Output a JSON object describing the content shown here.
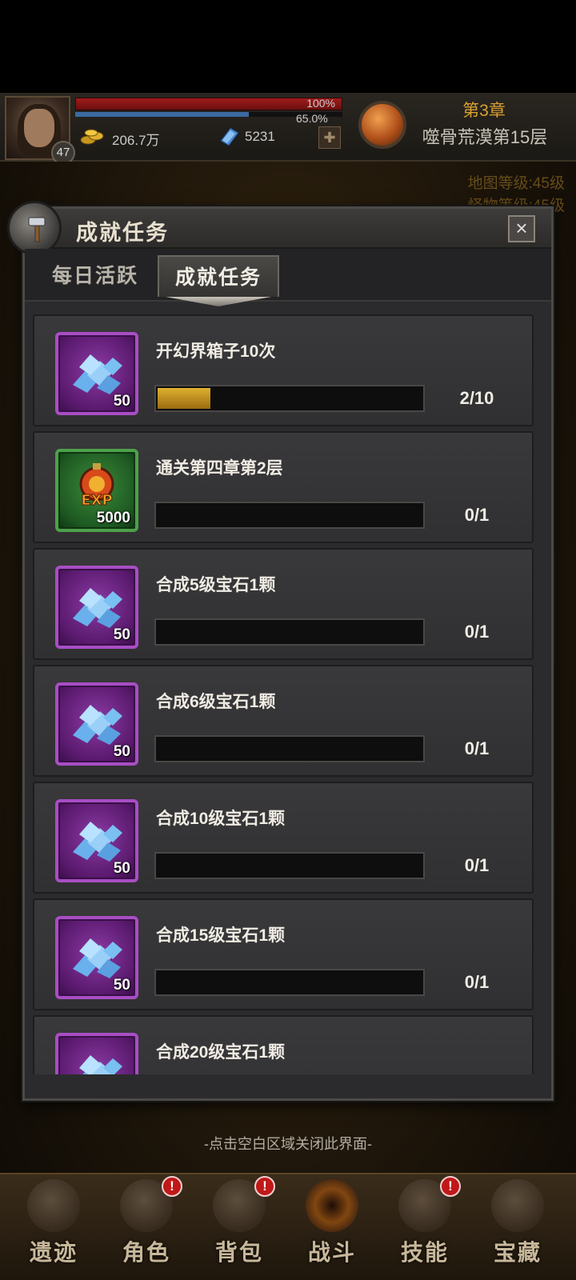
{
  "hud": {
    "level": "47",
    "hp_percent": "100%",
    "exp_percent": "65.0%",
    "gold": "206.7万",
    "gems": "5231",
    "chapter": "第3章",
    "stage": "噬骨荒漠第15层"
  },
  "map_info": [
    "地图等级:45级",
    "怪物等级:45级"
  ],
  "panel": {
    "title": "成就任务",
    "close_symbol": "×",
    "tabs": [
      {
        "label": "每日活跃",
        "active": false
      },
      {
        "label": "成就任务",
        "active": true
      }
    ]
  },
  "tasks": [
    {
      "title": "开幻界箱子10次",
      "reward_type": "gem",
      "reward_count": "50",
      "progress_text": "2/10",
      "progress": 0.2
    },
    {
      "title": "通关第四章第2层",
      "reward_type": "exp",
      "reward_count": "5000",
      "progress_text": "0/1",
      "progress": 0
    },
    {
      "title": "合成5级宝石1颗",
      "reward_type": "gem",
      "reward_count": "50",
      "progress_text": "0/1",
      "progress": 0
    },
    {
      "title": "合成6级宝石1颗",
      "reward_type": "gem",
      "reward_count": "50",
      "progress_text": "0/1",
      "progress": 0
    },
    {
      "title": "合成10级宝石1颗",
      "reward_type": "gem",
      "reward_count": "50",
      "progress_text": "0/1",
      "progress": 0
    },
    {
      "title": "合成15级宝石1颗",
      "reward_type": "gem",
      "reward_count": "50",
      "progress_text": "0/1",
      "progress": 0
    },
    {
      "title": "合成20级宝石1颗",
      "reward_type": "gem",
      "reward_count": "",
      "progress_text": "",
      "progress": 0
    }
  ],
  "hint": "-点击空白区域关闭此界面-",
  "nav": [
    {
      "label": "遗迹",
      "badge": ""
    },
    {
      "label": "角色",
      "badge": "!"
    },
    {
      "label": "背包",
      "badge": "!"
    },
    {
      "label": "战斗",
      "badge": ""
    },
    {
      "label": "技能",
      "badge": "!"
    },
    {
      "label": "宝藏",
      "badge": ""
    }
  ],
  "colors": {
    "accent_gold": "#d9a032",
    "progress_fill": "#e0b030",
    "panel_bg": "#2b2b2e",
    "reward_purple": "#a84ec4",
    "reward_green": "#4ea04a",
    "badge_red": "#c01818"
  }
}
